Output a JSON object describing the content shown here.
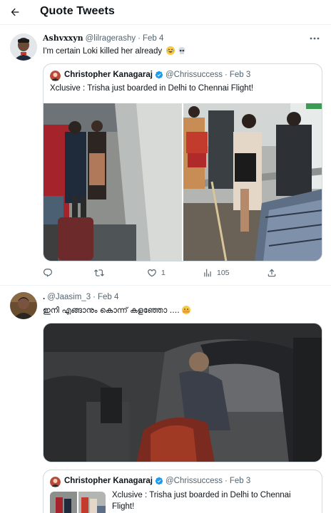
{
  "header": {
    "title": "Quote Tweets",
    "back_icon": "arrow-left-icon"
  },
  "tweets": [
    {
      "name": "Ashvxxyn",
      "handle": "@lilragerashy",
      "date": "Feb 4",
      "text": "I'm certain Loki killed her already",
      "emojis": [
        "😂",
        "💀"
      ],
      "quote": {
        "name": "Christopher Kanagaraj",
        "handle": "@Chrissuccess",
        "date": "Feb 3",
        "text": "Xclusive : Trisha just boarded in Delhi to Chennai Flight!"
      },
      "stats": {
        "likes": "1",
        "views": "105"
      }
    },
    {
      "name": ".",
      "handle": "@Jaasim_3",
      "date": "Feb 4",
      "text": "ഇനി എങ്ങാനും കൊന്ന് കളഞ്ഞോ ....",
      "emojis": [
        "🫣"
      ],
      "quote": {
        "name": "Christopher Kanagaraj",
        "handle": "@Chrissuccess",
        "date": "Feb 3",
        "text_line1": "Xclusive : Trisha just boarded in Delhi to Chennai",
        "text_line2": "Flight!"
      }
    }
  ],
  "colors": {
    "text": "#0f1419",
    "secondary": "#536471",
    "border": "#cfd9de",
    "verified": "#1d9bf0"
  }
}
